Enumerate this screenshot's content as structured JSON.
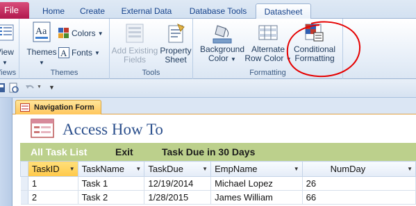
{
  "ribbon_tabs": {
    "file": "File",
    "home": "Home",
    "create": "Create",
    "external_data": "External Data",
    "database_tools": "Database Tools",
    "datasheet": "Datasheet"
  },
  "groups": {
    "views": {
      "view_label": "View",
      "label": "Views"
    },
    "themes": {
      "themes_label": "Themes",
      "colors_label": "Colors",
      "fonts_label": "Fonts",
      "label": "Themes"
    },
    "tools": {
      "add_existing_line1": "Add Existing",
      "add_existing_line2": "Fields",
      "property_line1": "Property",
      "property_line2": "Sheet",
      "label": "Tools"
    },
    "formatting": {
      "background_line1": "Background",
      "background_line2": "Color",
      "alternate_line1": "Alternate",
      "alternate_line2": "Row Color",
      "conditional_line1": "Conditional",
      "conditional_line2": "Formatting",
      "label": "Formatting"
    }
  },
  "form": {
    "tab_label": "Navigation Form",
    "title": "Access How To",
    "nav": {
      "all_task_list": "All Task List",
      "exit": "Exit",
      "task_due": "Task Due in 30 Days"
    }
  },
  "table": {
    "columns": [
      "TaskID",
      "TaskName",
      "TaskDue",
      "EmpName",
      "NumDay"
    ],
    "rows": [
      [
        "1",
        "Task 1",
        "12/19/2014",
        "Michael Lopez",
        "26"
      ],
      [
        "2",
        "Task 2",
        "1/28/2015",
        "James William",
        "66"
      ]
    ]
  },
  "colors": {
    "file_tab": "#c21f57",
    "accent_highlight": "#ff0000",
    "nav_bar": "#bcd08c",
    "selected_header": "#ffc94a"
  }
}
